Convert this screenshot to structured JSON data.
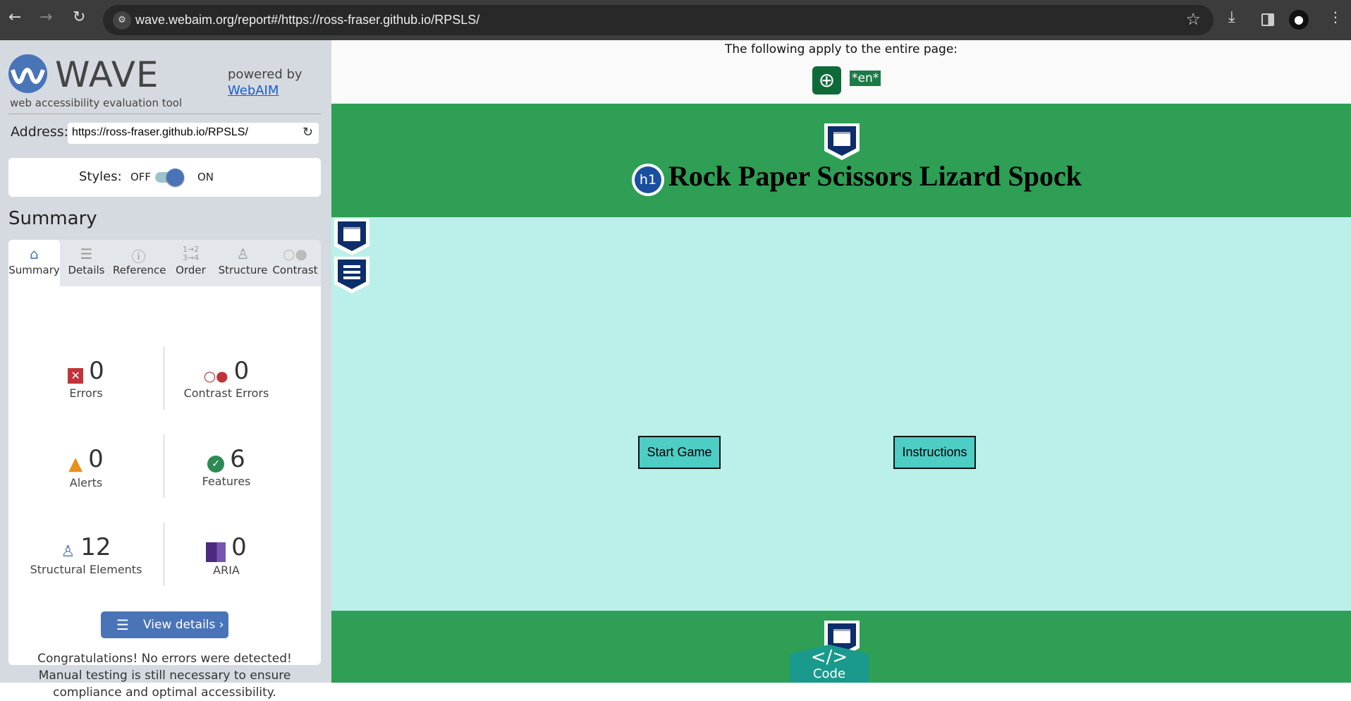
{
  "browser": {
    "url": "wave.webaim.org/report#/https://ross-fraser.github.io/RPSLS/"
  },
  "wave": {
    "logo_text": "WAVE",
    "tagline": "web accessibility evaluation tool",
    "powered_by": "powered by",
    "webaim_link": "WebAIM",
    "address_label": "Address:",
    "address_value": "https://ross-fraser.github.io/RPSLS/",
    "styles_label": "Styles:",
    "styles_off": "OFF",
    "styles_on": "ON",
    "styles_state": "on",
    "summary_heading": "Summary",
    "tabs": [
      {
        "label": "Summary",
        "icon": "home-icon"
      },
      {
        "label": "Details",
        "icon": "list-icon"
      },
      {
        "label": "Reference",
        "icon": "info-icon"
      },
      {
        "label": "Order",
        "icon": "order-icon"
      },
      {
        "label": "Structure",
        "icon": "structure-icon"
      },
      {
        "label": "Contrast",
        "icon": "contrast-icon"
      }
    ],
    "stats": {
      "errors": {
        "value": "0",
        "label": "Errors"
      },
      "contrast": {
        "value": "0",
        "label": "Contrast Errors"
      },
      "alerts": {
        "value": "0",
        "label": "Alerts"
      },
      "features": {
        "value": "6",
        "label": "Features"
      },
      "structural": {
        "value": "12",
        "label": "Structural Elements"
      },
      "aria": {
        "value": "0",
        "label": "ARIA"
      }
    },
    "view_details": "View details ›",
    "message": "Congratulations! No errors were detected! Manual testing is still necessary to ensure compliance and optimal accessibility."
  },
  "page": {
    "applies_text": "The following apply to the entire page:",
    "lang_badge": "*en*",
    "title": "Rock Paper Scissors Lizard Spock",
    "h1_badge": "h1",
    "start_button": "Start Game",
    "instructions_button": "Instructions",
    "code_tab": "Code",
    "code_glyph": "</>"
  },
  "colors": {
    "green": "#2e9f55",
    "cyan": "#bbf0ea",
    "wave_blue": "#4a74b8",
    "button": "#4ecdc4"
  }
}
